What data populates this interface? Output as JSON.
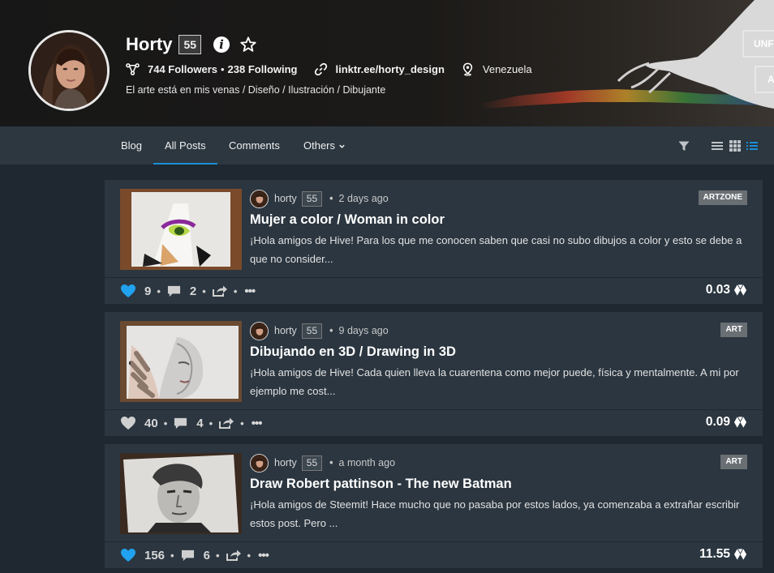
{
  "profile": {
    "name": "Horty",
    "reputation": "55",
    "followers": "744 Followers",
    "following": "238 Following",
    "stats_separator": "•",
    "link": "linktr.ee/horty_design",
    "location": "Venezuela",
    "about": "El arte está en mis venas / Diseño / Ilustración / Dibujante",
    "button_unfollow": "UNFO",
    "button_second": "A"
  },
  "nav": {
    "tabs": [
      {
        "label": "Blog"
      },
      {
        "label": "All Posts"
      },
      {
        "label": "Comments"
      },
      {
        "label": "Others"
      }
    ],
    "active_tab": "All Posts"
  },
  "posts": [
    {
      "author": "horty",
      "reputation": "55",
      "time": "2 days ago",
      "tag": "ARTZONE",
      "title": "Mujer a color / Woman in color",
      "excerpt": "¡Hola amigos de Hive! Para los que me conocen saben que casi no subo dibujos a color y esto se debe a que no consider...",
      "votes": "9",
      "comments": "2",
      "payout": "0.03",
      "voted": true
    },
    {
      "author": "horty",
      "reputation": "55",
      "time": "9 days ago",
      "tag": "ART",
      "title": "Dibujando en 3D / Drawing in 3D",
      "excerpt": "¡Hola amigos de Hive! Cada quien lleva la cuarentena como mejor puede, física y mentalmente. A mi por ejemplo me cost...",
      "votes": "40",
      "comments": "4",
      "payout": "0.09",
      "voted": false
    },
    {
      "author": "horty",
      "reputation": "55",
      "time": "a month ago",
      "tag": "ART",
      "title": "Draw Robert pattinson - The new Batman",
      "excerpt": "¡Hola amigos de Steemit! Hace mucho que no pasaba por estos lados, ya comenzaba a extrañar escribir estos post. Pero ...",
      "votes": "156",
      "comments": "6",
      "payout": "11.55",
      "voted": true
    }
  ],
  "ui": {
    "dot": "•",
    "more": "•••"
  },
  "colors": {
    "accent": "#1a8fd6",
    "voted_heart": "#21a2ef",
    "unvoted_heart": "#cfcfcf",
    "card_bg": "#2b3640",
    "page_bg": "#1f2830"
  }
}
